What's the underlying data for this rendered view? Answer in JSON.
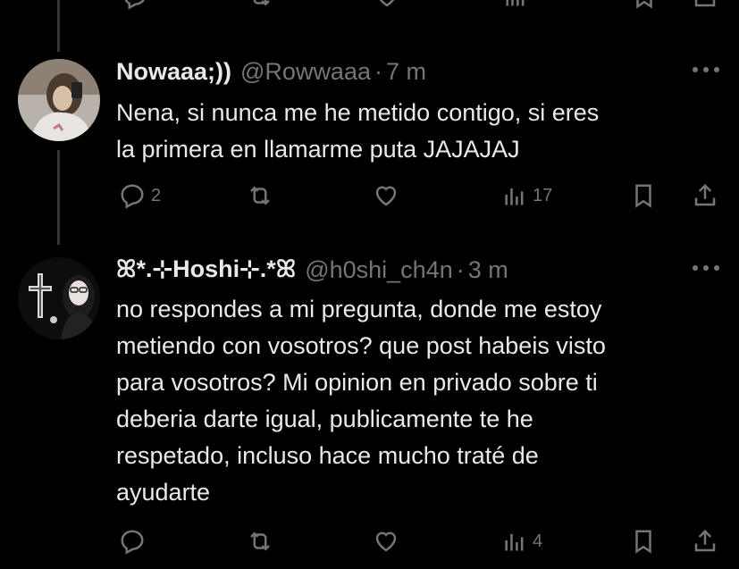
{
  "tweets": [
    {
      "name": "Nowaaa;))",
      "handle": "@Rowwaaa",
      "separator": "·",
      "time": "7 m",
      "text_lines": [
        "Nena, si nunca me he metido contigo, si eres",
        "la primera en llamarme puta JAJAJAJ"
      ],
      "replies": "2",
      "reposts": "",
      "likes": "",
      "views": "17"
    },
    {
      "name": "ꕤ*.⊹Hoshi⊹.*ꕤ",
      "handle": "@h0shi_ch4n",
      "separator": "·",
      "time": "3 m",
      "text_lines": [
        "no respondes a mi pregunta, donde me estoy",
        "metiendo con vosotros? que post habeis visto",
        "para vosotros? Mi opinion en privado sobre ti",
        "deberia darte igual, publicamente te he",
        "respetado, incluso hace mucho traté de",
        "ayudarte"
      ],
      "replies": "",
      "reposts": "",
      "likes": "",
      "views": "4"
    }
  ],
  "icons": {
    "reply": "reply-icon",
    "repost": "repost-icon",
    "like": "heart-icon",
    "views": "views-chart-icon",
    "bookmark": "bookmark-icon",
    "share": "share-icon",
    "more": "more-dots-icon"
  },
  "colors": {
    "background": "#000000",
    "text": "#e7e9ea",
    "muted": "#71767b",
    "thread_line": "#333639"
  }
}
